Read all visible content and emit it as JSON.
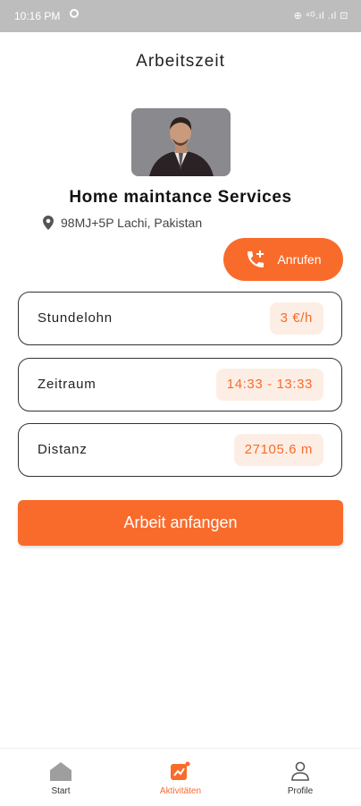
{
  "status_bar": {
    "time": "10:16 PM",
    "right": "⊕ ⁴ᴳ.ıl .ıl ⊡"
  },
  "header": {
    "title": "Arbeitszeit"
  },
  "profile": {
    "company": "Home maintance Services",
    "location": "98MJ+5P Lachi, Pakistan"
  },
  "call_button": {
    "label": "Anrufen"
  },
  "info": [
    {
      "label": "Stundelohn",
      "value": "3 €/h"
    },
    {
      "label": "Zeitraum",
      "value": "14:33 - 13:33"
    },
    {
      "label": "Distanz",
      "value": "27105.6 m"
    }
  ],
  "start_button": {
    "label": "Arbeit anfangen"
  },
  "tabs": [
    {
      "label": "Start",
      "icon": "home-icon"
    },
    {
      "label": "Aktivitäten",
      "icon": "activity-icon"
    },
    {
      "label": "Profile",
      "icon": "person-icon"
    }
  ],
  "colors": {
    "accent": "#f96b2b",
    "accent_light": "#fdeee5"
  }
}
